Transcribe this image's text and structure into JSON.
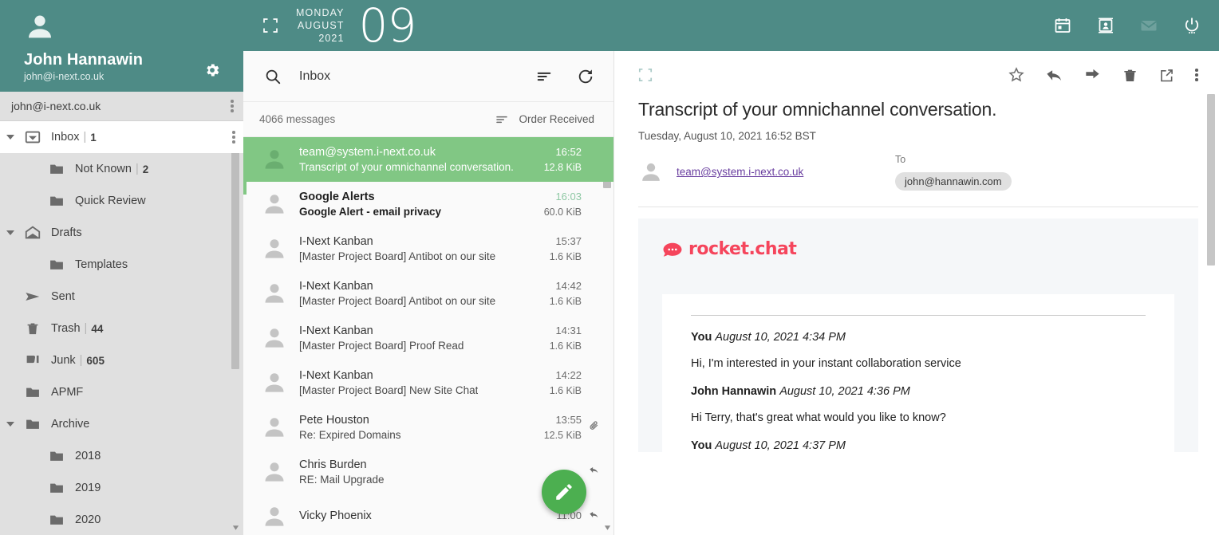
{
  "account": {
    "name": "John Hannawin",
    "email": "john@i-next.co.uk",
    "row_email": "john@i-next.co.uk",
    "avatar_icon": "person-icon",
    "settings_icon": "gear-icon"
  },
  "folders": [
    {
      "label": "Inbox",
      "count": "1",
      "icon": "inbox-icon",
      "twisty": true,
      "child": false,
      "selected": true,
      "menu": true
    },
    {
      "label": "Not Known",
      "count": "2",
      "icon": "folder-icon",
      "twisty": false,
      "child": true,
      "selected": false,
      "menu": false
    },
    {
      "label": "Quick Review",
      "count": "",
      "icon": "folder-icon",
      "twisty": false,
      "child": true,
      "selected": false,
      "menu": false
    },
    {
      "label": "Drafts",
      "count": "",
      "icon": "drafts-icon",
      "twisty": true,
      "child": false,
      "selected": false,
      "menu": false
    },
    {
      "label": "Templates",
      "count": "",
      "icon": "folder-icon",
      "twisty": false,
      "child": true,
      "selected": false,
      "menu": false
    },
    {
      "label": "Sent",
      "count": "",
      "icon": "sent-icon",
      "twisty": false,
      "child": false,
      "selected": false,
      "menu": false
    },
    {
      "label": "Trash",
      "count": "44",
      "icon": "trash-icon",
      "twisty": false,
      "child": false,
      "selected": false,
      "menu": false
    },
    {
      "label": "Junk",
      "count": "605",
      "icon": "junk-icon",
      "twisty": false,
      "child": false,
      "selected": false,
      "menu": false
    },
    {
      "label": "APMF",
      "count": "",
      "icon": "folder-icon",
      "twisty": false,
      "child": false,
      "selected": false,
      "menu": false
    },
    {
      "label": "Archive",
      "count": "",
      "icon": "folder-icon",
      "twisty": true,
      "child": false,
      "selected": false,
      "menu": false
    },
    {
      "label": "2018",
      "count": "",
      "icon": "folder-icon",
      "twisty": false,
      "child": true,
      "selected": false,
      "menu": false
    },
    {
      "label": "2019",
      "count": "",
      "icon": "folder-icon",
      "twisty": false,
      "child": true,
      "selected": false,
      "menu": false
    },
    {
      "label": "2020",
      "count": "",
      "icon": "folder-icon",
      "twisty": false,
      "child": true,
      "selected": false,
      "menu": false
    }
  ],
  "topbar": {
    "expand_icon": "fullscreen-icon",
    "weekday": "MONDAY",
    "month": "AUGUST",
    "year": "2021",
    "day": "09",
    "icons": [
      "calendar-icon",
      "contacts-icon",
      "mail-icon",
      "power-icon"
    ]
  },
  "list": {
    "search_icon": "search-icon",
    "search_value": "Inbox",
    "sort_icon": "sort-icon",
    "refresh_icon": "refresh-icon",
    "count_text": "4066 messages",
    "order_icon": "sort-icon",
    "order_label": "Order Received",
    "compose_icon": "pencil-icon",
    "messages": [
      {
        "from": "team@system.i-next.co.uk",
        "subject": "Transcript of your omnichannel conversation.",
        "time": "16:52",
        "size": "12.8 KiB",
        "selected": true,
        "unread": false,
        "attachment": false,
        "replied": false
      },
      {
        "from": "Google Alerts",
        "subject": "Google Alert - email privacy",
        "time": "16:03",
        "size": "60.0 KiB",
        "selected": false,
        "unread": true,
        "attachment": false,
        "replied": false
      },
      {
        "from": "I-Next Kanban",
        "subject": "[Master Project Board] Antibot on our site",
        "time": "15:37",
        "size": "1.6 KiB",
        "selected": false,
        "unread": false,
        "attachment": false,
        "replied": false
      },
      {
        "from": "I-Next Kanban",
        "subject": "[Master Project Board] Antibot on our site",
        "time": "14:42",
        "size": "1.6 KiB",
        "selected": false,
        "unread": false,
        "attachment": false,
        "replied": false
      },
      {
        "from": "I-Next Kanban",
        "subject": "[Master Project Board] Proof Read",
        "time": "14:31",
        "size": "1.6 KiB",
        "selected": false,
        "unread": false,
        "attachment": false,
        "replied": false
      },
      {
        "from": "I-Next Kanban",
        "subject": "[Master Project Board] New Site Chat",
        "time": "14:22",
        "size": "1.6 KiB",
        "selected": false,
        "unread": false,
        "attachment": false,
        "replied": false
      },
      {
        "from": "Pete Houston",
        "subject": "Re: Expired Domains",
        "time": "13:55",
        "size": "12.5 KiB",
        "selected": false,
        "unread": false,
        "attachment": true,
        "replied": false
      },
      {
        "from": "Chris Burden",
        "subject": "RE: Mail Upgrade",
        "time": "",
        "size": "",
        "selected": false,
        "unread": false,
        "attachment": false,
        "replied": true
      },
      {
        "from": "Vicky Phoenix",
        "subject": "",
        "time": "11:00",
        "size": "",
        "selected": false,
        "unread": false,
        "attachment": false,
        "replied": true
      }
    ]
  },
  "reader": {
    "expand_icon": "fullscreen-icon",
    "actions": [
      "star-icon",
      "reply-icon",
      "forward-icon",
      "trash-icon",
      "open-external-icon",
      "more-vertical-icon"
    ],
    "subject": "Transcript of your omnichannel conversation.",
    "date": "Tuesday, August 10, 2021 16:52 BST",
    "sender": "team@system.i-next.co.uk",
    "to_label": "To",
    "to_chip": "john@hannawin.com",
    "logo_text": "rocket.chat",
    "transcript": [
      {
        "author": "You",
        "stamp": "August 10, 2021 4:34 PM",
        "message": "Hi, I'm interested in your instant collaboration service"
      },
      {
        "author": "John Hannawin",
        "stamp": "August 10, 2021 4:36 PM",
        "message": "Hi Terry, that's great what would you like to know?"
      },
      {
        "author": "You",
        "stamp": "August 10, 2021 4:37 PM",
        "message": ""
      }
    ]
  },
  "colors": {
    "teal": "#4e8b86",
    "green_selected": "#81c784",
    "fab_green": "#4caf50",
    "rocket_red": "#f5455c",
    "link_purple": "#6a3fa0"
  }
}
